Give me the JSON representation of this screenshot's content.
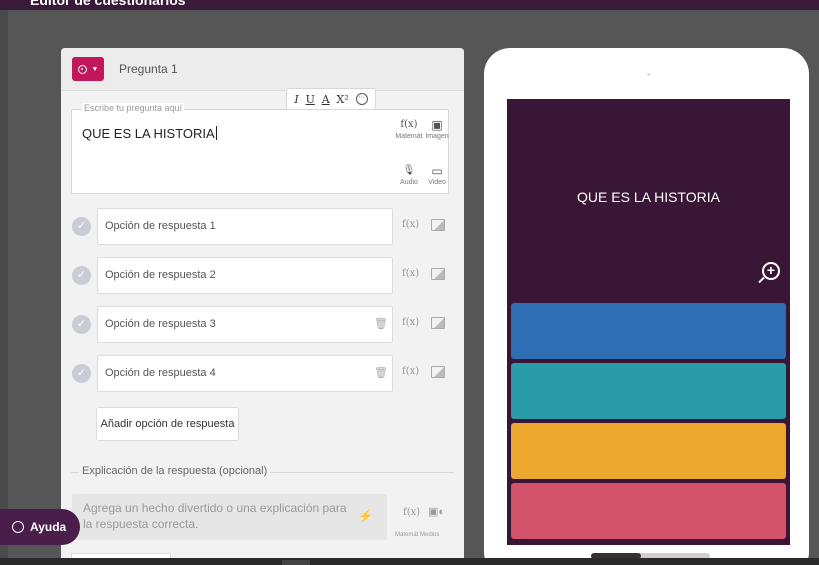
{
  "app": {
    "title": "Editor de cuestionarios"
  },
  "question": {
    "label": "Pregunta 1",
    "prompt_legend": "Escribe tu pregunta aquí",
    "text": "QUE ES LA HISTORIA"
  },
  "format_toolbar": {
    "italic": "I",
    "underline": "U",
    "color": "A",
    "superscript": "X²",
    "more": "···"
  },
  "media_tools": [
    {
      "icon": "fx-icon",
      "glyph": "f(x)",
      "label": "Matemát"
    },
    {
      "icon": "image-icon",
      "glyph": "▣",
      "label": "Imagen"
    },
    {
      "icon": "microphone-icon",
      "glyph": "🎙",
      "label": "Audio"
    },
    {
      "icon": "video-icon",
      "glyph": "▭",
      "label": "Video"
    }
  ],
  "options": [
    {
      "placeholder": "Opción de respuesta 1",
      "deletable": false
    },
    {
      "placeholder": "Opción de respuesta 2",
      "deletable": false
    },
    {
      "placeholder": "Opción de respuesta 3",
      "deletable": true
    },
    {
      "placeholder": "Opción de respuesta 4",
      "deletable": true
    }
  ],
  "option_tools": {
    "fx": "f(x)"
  },
  "add_option_label": "Añadir opción de respuesta",
  "explanation": {
    "legend": "Explicación de la respuesta (opcional)",
    "placeholder": "Agrega un hecho divertido o una explicación para la respuesta correcta.",
    "fx": "f(x)",
    "tools_label": "Matemát Medios"
  },
  "help": {
    "label": "Ayuda"
  },
  "preview": {
    "question_text": "QUE ES LA HISTORIA",
    "answer_colors": [
      "#2f6db5",
      "#2a9ba8",
      "#eba72e",
      "#d3546a"
    ]
  }
}
